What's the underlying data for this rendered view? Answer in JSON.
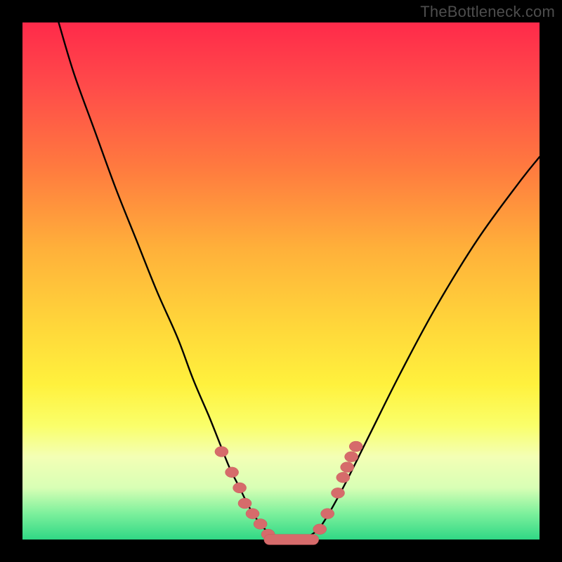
{
  "watermark": "TheBottleneck.com",
  "colors": {
    "curve": "#000000",
    "marker_fill": "#d66b6b",
    "marker_stroke": "#c85a5a",
    "background_frame": "#000000"
  },
  "chart_data": {
    "type": "line",
    "title": "",
    "xlabel": "",
    "ylabel": "",
    "xlim": [
      0,
      100
    ],
    "ylim": [
      0,
      100
    ],
    "grid": false,
    "legend": false,
    "note": "Values are estimated from pixel positions; axes are implicit (no tick labels in image).",
    "series": [
      {
        "name": "bottleneck-curve",
        "x": [
          7,
          10,
          14,
          18,
          22,
          26,
          30,
          33,
          36,
          38,
          40,
          42,
          44,
          46,
          48,
          50,
          52,
          54,
          56,
          58,
          62,
          67,
          73,
          80,
          88,
          96,
          100
        ],
        "y": [
          100,
          90,
          79,
          68,
          58,
          48,
          39,
          31,
          24,
          19,
          14,
          10,
          6,
          3,
          1,
          0,
          0,
          0,
          1,
          3,
          10,
          20,
          32,
          45,
          58,
          69,
          74
        ]
      }
    ],
    "markers": {
      "name": "highlighted-points",
      "left_cluster": [
        {
          "x": 38.5,
          "y": 17
        },
        {
          "x": 40.5,
          "y": 13
        },
        {
          "x": 42.0,
          "y": 10
        },
        {
          "x": 43.0,
          "y": 7
        },
        {
          "x": 44.5,
          "y": 5
        },
        {
          "x": 46.0,
          "y": 3
        },
        {
          "x": 47.5,
          "y": 1
        }
      ],
      "bottom_bar": {
        "x_start": 48,
        "x_end": 56,
        "y": 0
      },
      "right_cluster": [
        {
          "x": 57.5,
          "y": 2
        },
        {
          "x": 59.0,
          "y": 5
        },
        {
          "x": 61.0,
          "y": 9
        },
        {
          "x": 62.0,
          "y": 12
        },
        {
          "x": 62.8,
          "y": 14
        },
        {
          "x": 63.6,
          "y": 16
        },
        {
          "x": 64.5,
          "y": 18
        }
      ]
    }
  }
}
